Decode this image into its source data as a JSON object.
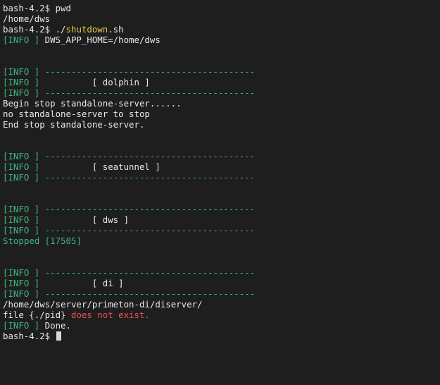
{
  "colors": {
    "background": "#1e1e1e",
    "default": "#e8e8e8",
    "green": "#3fb680",
    "yellow": "#e6c84c",
    "red": "#ec5252",
    "cursor": "#d8d8d8"
  },
  "terminal": {
    "lines": [
      {
        "segments": [
          {
            "text": "bash-4.2$ pwd"
          }
        ]
      },
      {
        "segments": [
          {
            "text": "/home/dws"
          }
        ]
      },
      {
        "segments": [
          {
            "text": "bash-4.2$ ./"
          },
          {
            "text": "shutdown",
            "color": "yellow"
          },
          {
            "text": ".sh"
          }
        ]
      },
      {
        "segments": [
          {
            "text": "[INFO ]",
            "color": "green"
          },
          {
            "text": " DWS_APP_HOME=/home/dws"
          }
        ]
      },
      {
        "segments": []
      },
      {
        "segments": []
      },
      {
        "segments": [
          {
            "text": "[INFO ]",
            "color": "green"
          },
          {
            "text": " ----------------------------------------",
            "color": "green"
          }
        ]
      },
      {
        "segments": [
          {
            "text": "[INFO ]",
            "color": "green"
          },
          {
            "text": "          [ dolphin ]"
          }
        ]
      },
      {
        "segments": [
          {
            "text": "[INFO ]",
            "color": "green"
          },
          {
            "text": " ----------------------------------------",
            "color": "green"
          }
        ]
      },
      {
        "segments": [
          {
            "text": "Begin stop standalone-server......"
          }
        ]
      },
      {
        "segments": [
          {
            "text": "no standalone-server to stop"
          }
        ]
      },
      {
        "segments": [
          {
            "text": "End stop standalone-server."
          }
        ]
      },
      {
        "segments": []
      },
      {
        "segments": []
      },
      {
        "segments": [
          {
            "text": "[INFO ]",
            "color": "green"
          },
          {
            "text": " ----------------------------------------",
            "color": "green"
          }
        ]
      },
      {
        "segments": [
          {
            "text": "[INFO ]",
            "color": "green"
          },
          {
            "text": "          [ seatunnel ]"
          }
        ]
      },
      {
        "segments": [
          {
            "text": "[INFO ]",
            "color": "green"
          },
          {
            "text": " ----------------------------------------",
            "color": "green"
          }
        ]
      },
      {
        "segments": []
      },
      {
        "segments": []
      },
      {
        "segments": [
          {
            "text": "[INFO ]",
            "color": "green"
          },
          {
            "text": " ----------------------------------------",
            "color": "green"
          }
        ]
      },
      {
        "segments": [
          {
            "text": "[INFO ]",
            "color": "green"
          },
          {
            "text": "          [ dws ]"
          }
        ]
      },
      {
        "segments": [
          {
            "text": "[INFO ]",
            "color": "green"
          },
          {
            "text": " ----------------------------------------",
            "color": "green"
          }
        ]
      },
      {
        "segments": [
          {
            "text": "Stopped [17505]",
            "color": "green"
          }
        ]
      },
      {
        "segments": []
      },
      {
        "segments": []
      },
      {
        "segments": [
          {
            "text": "[INFO ]",
            "color": "green"
          },
          {
            "text": " ----------------------------------------",
            "color": "green"
          }
        ]
      },
      {
        "segments": [
          {
            "text": "[INFO ]",
            "color": "green"
          },
          {
            "text": "          [ di ]"
          }
        ]
      },
      {
        "segments": [
          {
            "text": "[INFO ]",
            "color": "green"
          },
          {
            "text": " ----------------------------------------",
            "color": "green"
          }
        ]
      },
      {
        "segments": [
          {
            "text": "/home/dws/server/primeton-di/diserver/"
          }
        ]
      },
      {
        "segments": [
          {
            "text": "file {./pid} "
          },
          {
            "text": "does not exist.",
            "color": "red"
          }
        ]
      },
      {
        "segments": [
          {
            "text": "[INFO ]",
            "color": "green"
          },
          {
            "text": " Done."
          }
        ]
      },
      {
        "segments": [
          {
            "text": "bash-4.2$ "
          }
        ],
        "cursor": true
      }
    ]
  }
}
